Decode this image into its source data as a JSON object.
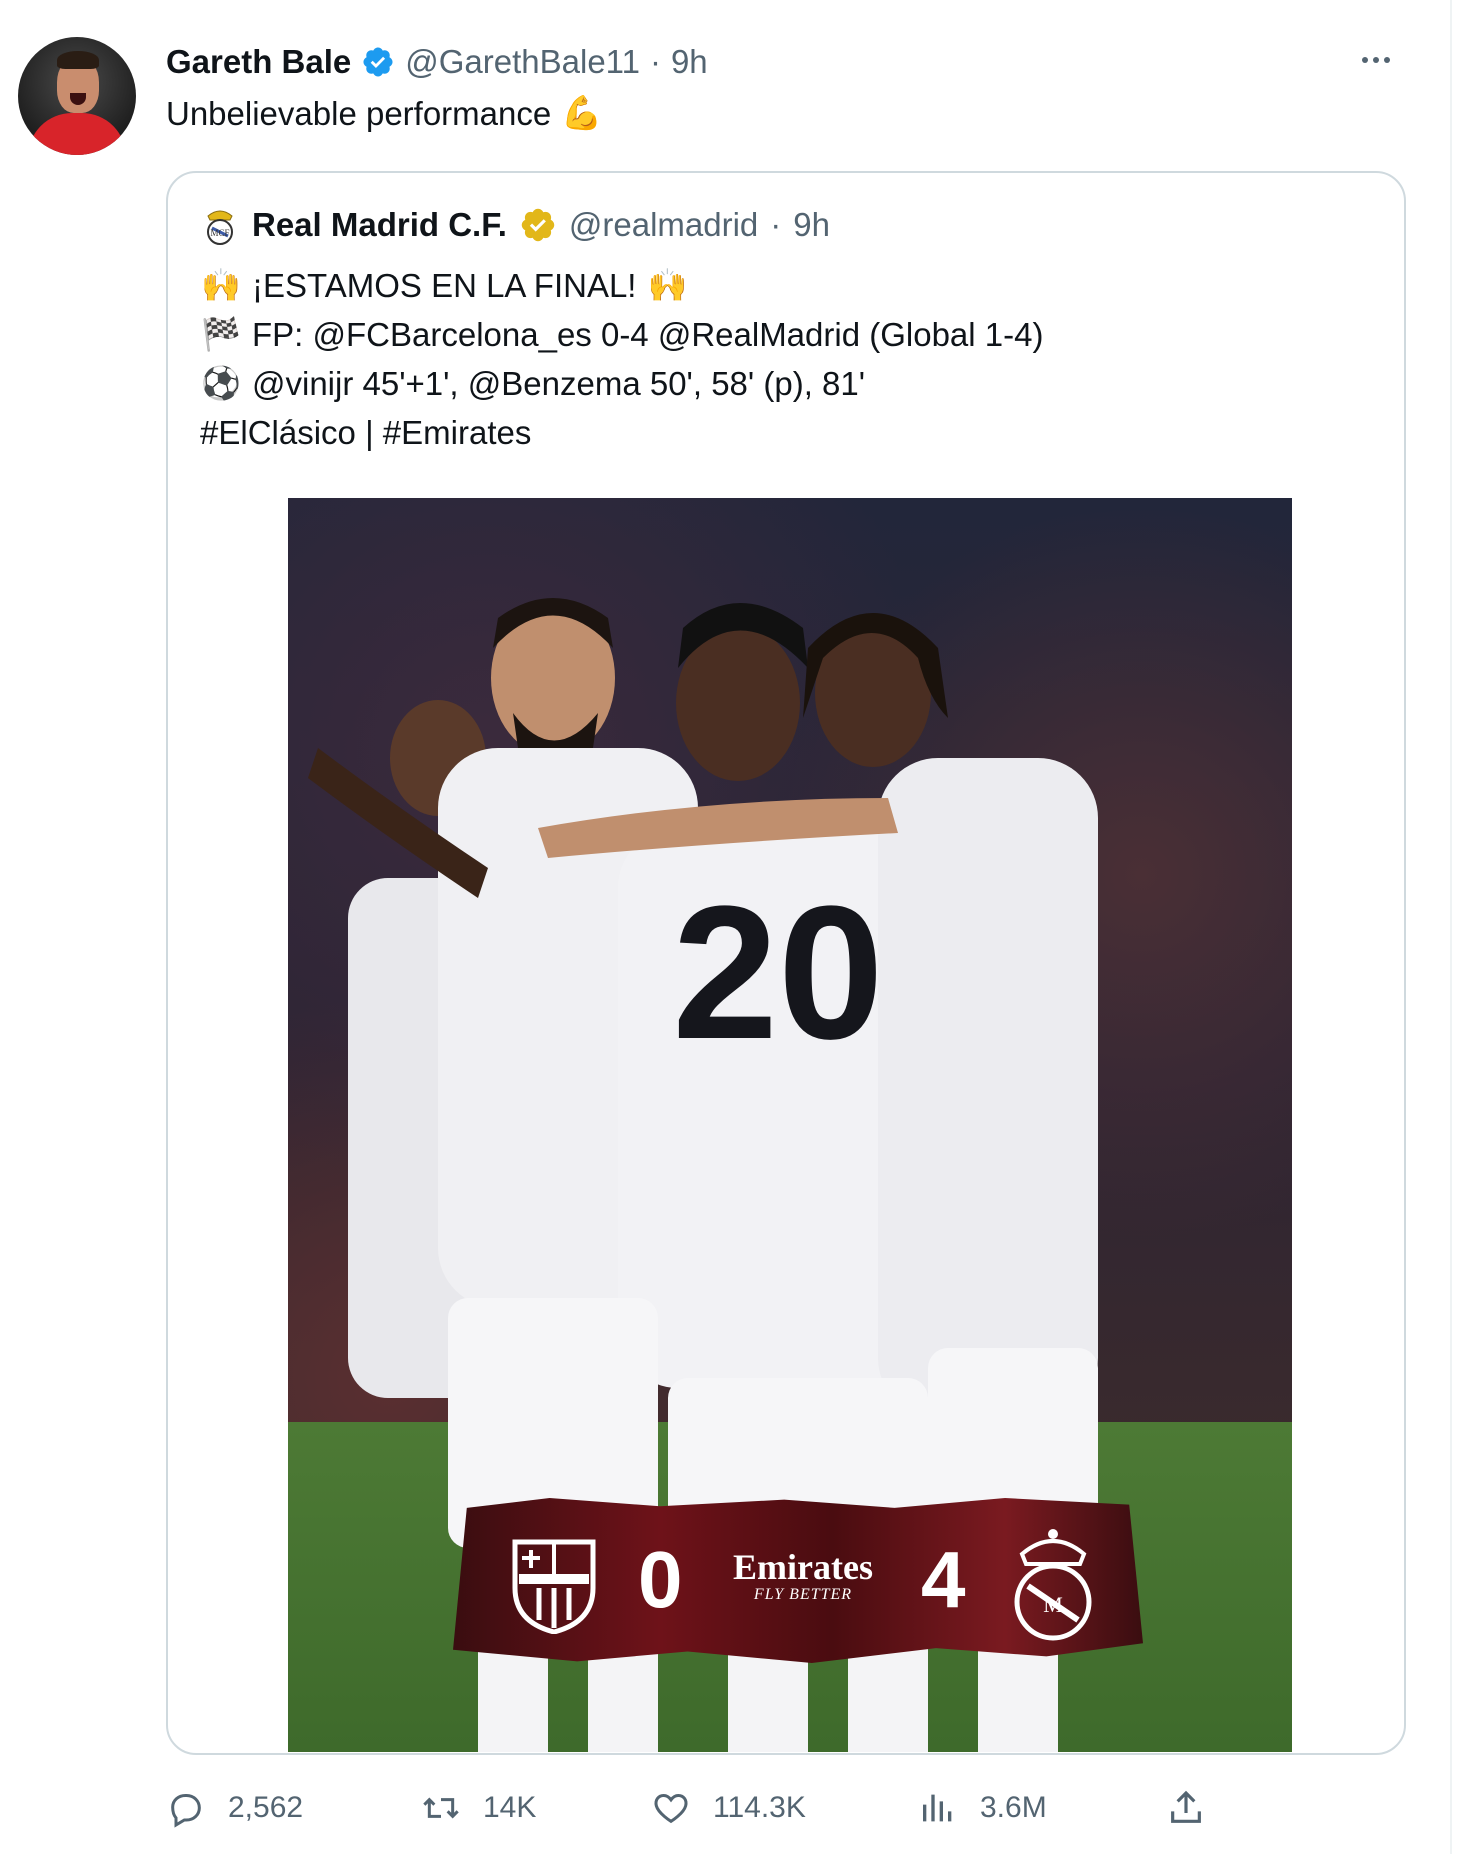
{
  "tweet": {
    "display_name": "Gareth Bale",
    "handle": "@GarethBale11",
    "separator": "·",
    "time": "9h",
    "text": "Unbelievable performance",
    "text_emoji": "💪"
  },
  "quoted_tweet": {
    "display_name": "Real Madrid C.F.",
    "handle": "@realmadrid",
    "separator": "·",
    "time": "9h",
    "lines": [
      {
        "icon": "🙌",
        "text": "¡ESTAMOS EN LA FINAL!",
        "trail_icon": "🙌"
      },
      {
        "icon": "🏁",
        "text": "FP: @FCBarcelona_es 0-4 @RealMadrid (Global 1-4)"
      },
      {
        "icon": "⚽",
        "text": "@vinijr 45'+1', @Benzema 50', 58' (p), 81'"
      },
      {
        "icon": "",
        "text": "#ElClásico | #Emirates"
      }
    ],
    "image": {
      "score_home": "0",
      "score_away": "4",
      "sponsor": "Emirates",
      "sponsor_tagline": "FLY BETTER",
      "shirt_number": "20"
    }
  },
  "actions": {
    "replies": "2,562",
    "retweets": "14K",
    "likes": "114.3K",
    "views": "3.6M"
  },
  "colors": {
    "verified_blue": "#1d9bf0",
    "verified_gold": "#e2b719",
    "muted_text": "#536471",
    "border": "#cfd9de"
  }
}
